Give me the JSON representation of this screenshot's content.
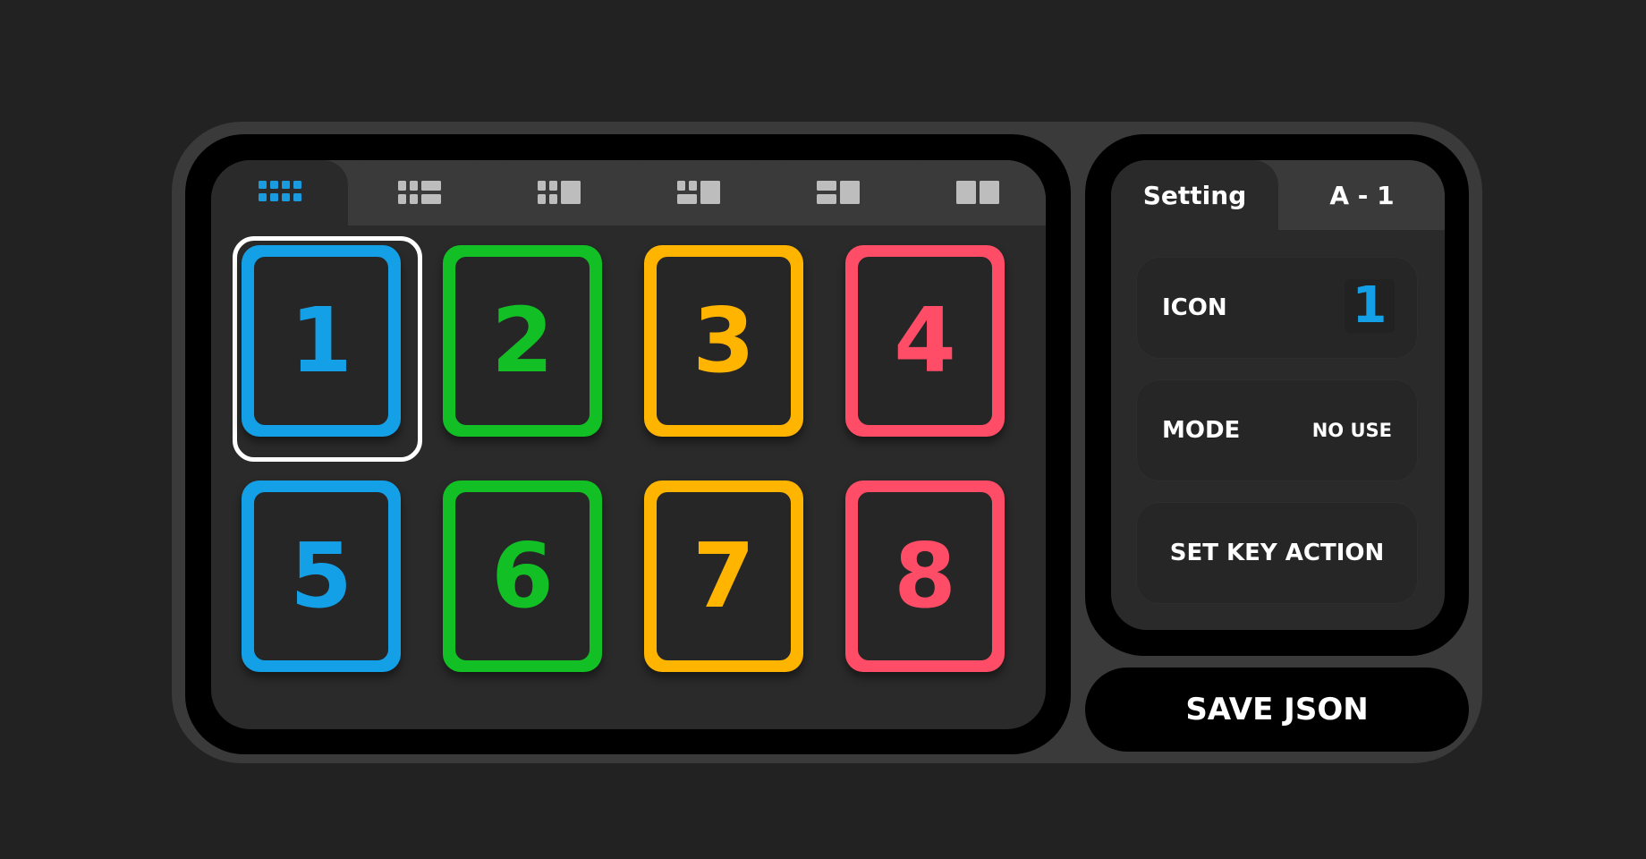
{
  "layout_tabs": [
    {
      "icon": "grid-4x2-icon",
      "active": true
    },
    {
      "icon": "grid-3x2-icon",
      "active": false
    },
    {
      "icon": "grid-2x2-wide-icon",
      "active": false
    },
    {
      "icon": "grid-2x1-mixed-icon",
      "active": false
    },
    {
      "icon": "grid-1x2-mixed-icon",
      "active": false
    },
    {
      "icon": "grid-2x1-icon",
      "active": false
    }
  ],
  "colors": {
    "accent_active": "#1a9be0",
    "blue": "#14a0e6",
    "green": "#12c026",
    "yellow": "#ffb400",
    "red": "#ff4d67",
    "inactive_icon": "#bdbdbd"
  },
  "keys": [
    {
      "label": "1",
      "color": "#14a0e6",
      "selected": true
    },
    {
      "label": "2",
      "color": "#12c026",
      "selected": false
    },
    {
      "label": "3",
      "color": "#ffb400",
      "selected": false
    },
    {
      "label": "4",
      "color": "#ff4d67",
      "selected": false
    },
    {
      "label": "5",
      "color": "#14a0e6",
      "selected": false
    },
    {
      "label": "6",
      "color": "#12c026",
      "selected": false
    },
    {
      "label": "7",
      "color": "#ffb400",
      "selected": false
    },
    {
      "label": "8",
      "color": "#ff4d67",
      "selected": false
    }
  ],
  "settings_panel": {
    "tabs": [
      {
        "label": "Setting",
        "active": true
      },
      {
        "label": "A - 1",
        "active": false
      }
    ],
    "icon_row": {
      "label": "ICON",
      "value": "1"
    },
    "mode_row": {
      "label": "MODE",
      "value": "NO USE"
    },
    "action_button": "SET KEY ACTION"
  },
  "save_button": "SAVE JSON"
}
